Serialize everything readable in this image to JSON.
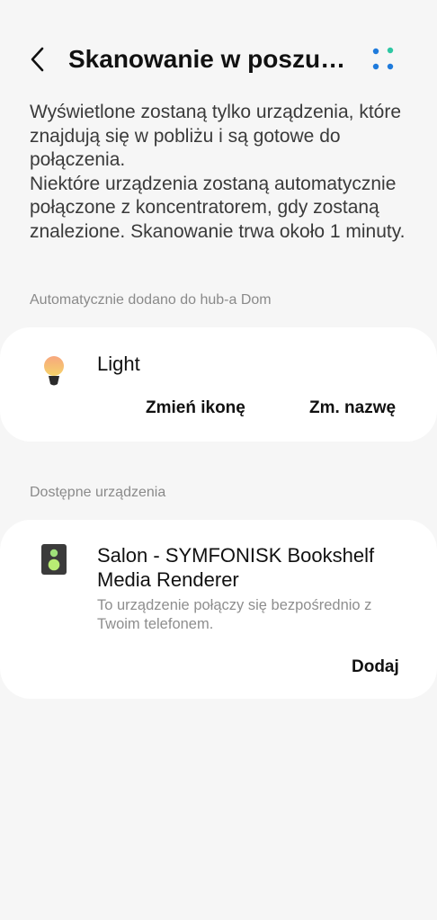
{
  "header": {
    "title": "Skanowanie w poszuki…",
    "back_icon": "chevron-left-icon",
    "scan_icon": "dots-scan-icon"
  },
  "description": {
    "line1": "Wyświetlone zostaną tylko urządzenia, które znajdują się w pobliżu i są gotowe do połączenia.",
    "line2": "Niektóre urządzenia zostaną automatycznie połączone z koncentratorem, gdy zostaną znalezione. Skanowanie trwa około 1 minuty."
  },
  "auto_added": {
    "section_label": "Automatycznie dodano do hub-a Dom",
    "device": {
      "name": "Light",
      "icon": "light-bulb-icon",
      "change_icon_label": "Zmień ikonę",
      "rename_label": "Zm. nazwę"
    }
  },
  "available": {
    "section_label": "Dostępne urządzenia",
    "device": {
      "name": "Salon - SYMFONISK Bookshelf Media Renderer",
      "icon": "speaker-icon",
      "subtitle": "To urządzenie połączy się bezpośrednio z Twoim telefonem.",
      "add_label": "Dodaj"
    }
  },
  "colors": {
    "background": "#f6f6f6",
    "card": "#ffffff",
    "scan_blue": "#1f7bdc",
    "scan_green": "#2ec7a3"
  }
}
